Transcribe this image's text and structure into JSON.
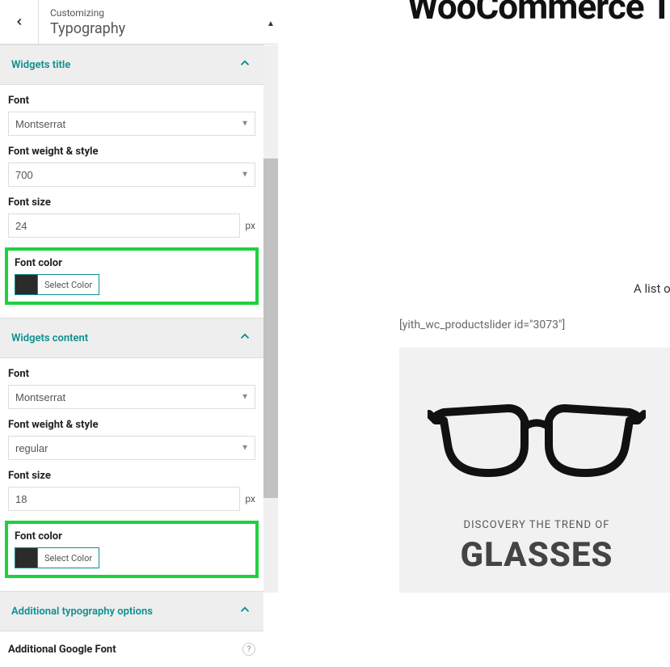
{
  "header": {
    "sub": "Customizing",
    "title": "Typography"
  },
  "sections": {
    "widgets_title": {
      "title": "Widgets title",
      "font_label": "Font",
      "font_value": "Montserrat",
      "weight_label": "Font weight & style",
      "weight_value": "700",
      "size_label": "Font size",
      "size_value": "24",
      "size_unit": "px",
      "color_label": "Font color",
      "color_btn": "Select Color",
      "color_value": "#2b2b2b"
    },
    "widgets_content": {
      "title": "Widgets content",
      "font_label": "Font",
      "font_value": "Montserrat",
      "weight_label": "Font weight & style",
      "weight_value": "regular",
      "size_label": "Font size",
      "size_value": "18",
      "size_unit": "px",
      "color_label": "Font color",
      "color_btn": "Select Color",
      "color_value": "#2b2b2b"
    },
    "additional": {
      "title": "Additional typography options",
      "google_font_label": "Additional Google Font",
      "help": "?"
    }
  },
  "preview": {
    "title_cut": "WooCommerce Te",
    "subtitle": "A list o",
    "shortcode": "[yith_wc_productslider id=\"3073\"]",
    "card_tag": "DISCOVERY THE TREND OF",
    "card_big": "GLASSES"
  }
}
